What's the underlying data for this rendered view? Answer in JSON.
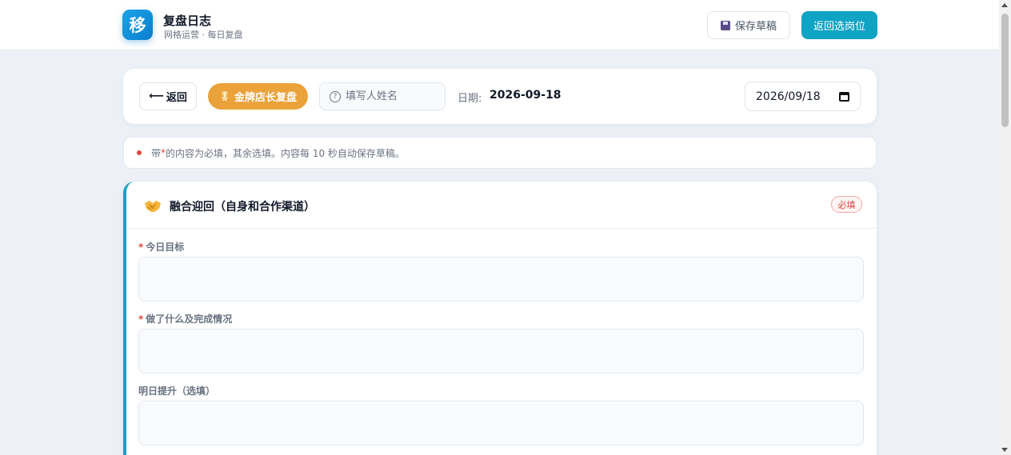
{
  "header": {
    "logo_char": "移",
    "title": "复盘日志",
    "subtitle": "网格运营 · 每日复盘",
    "save_draft_label": "保存草稿",
    "back_to_select_label": "返回选岗位"
  },
  "toolbar": {
    "back_arrow": "⟵",
    "back_label": "返回",
    "role_badge_label": "金牌店长复盘",
    "name_placeholder": "填写人姓名",
    "date_label": "日期:",
    "date_value": "2026-09-18",
    "date_picker_value": "2026/09/18"
  },
  "notice": {
    "prefix": "带 ",
    "star": "*",
    "suffix": " 的内容为必填，其余选填。内容每 10 秒自动保存草稿。"
  },
  "section": {
    "title": "融合迎回（自身和合作渠道）",
    "required_badge": "必填",
    "fields": [
      {
        "label": "今日目标",
        "required": true,
        "value": ""
      },
      {
        "label": "做了什么及完成情况",
        "required": true,
        "value": ""
      },
      {
        "label": "明日提升（选填）",
        "required": false,
        "value": ""
      }
    ]
  },
  "colors": {
    "accent": "#13a3c2",
    "role_badge": "#eba23b",
    "required": "#e0483e"
  },
  "icons": [
    "floppy-disk-icon",
    "medal-icon",
    "question-circle-icon",
    "calendar-icon",
    "handshake-icon"
  ]
}
